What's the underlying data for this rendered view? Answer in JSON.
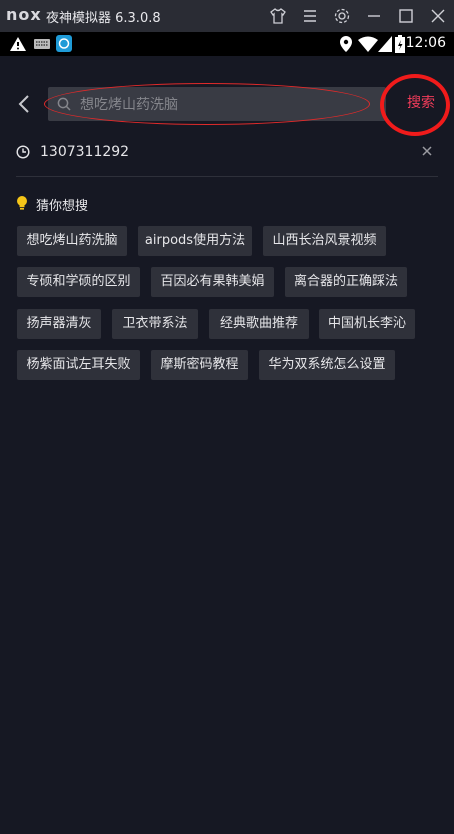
{
  "emulator": {
    "logo": "nox",
    "title": "夜神模拟器 6.3.0.8",
    "icons": [
      "shirt-icon",
      "menu-icon",
      "gear-icon",
      "minimize-icon",
      "maximize-icon",
      "close-icon"
    ]
  },
  "statusbar": {
    "icons": [
      "warning-icon",
      "keyboard-icon",
      "app-icon",
      "location-icon",
      "wifi-icon",
      "signal-icon",
      "battery-icon"
    ],
    "time": "12:06"
  },
  "search": {
    "placeholder": "想吃烤山药洗脑",
    "button": "搜索",
    "annotation_color": "#e02a2a"
  },
  "history": {
    "items": [
      {
        "text": "1307311292"
      }
    ]
  },
  "suggestions": {
    "title": "猜你想搜",
    "items": [
      "想吃烤山药洗脑",
      "airpods使用方法",
      "山西长治风景视频",
      "专硕和学硕的区别",
      "百因必有果韩美娟",
      "离合器的正确踩法",
      "扬声器清灰",
      "卫衣带系法",
      "经典歌曲推荐",
      "中国机长李沁",
      "杨紫面试左耳失败",
      "摩斯密码教程",
      "华为双系统怎么设置"
    ]
  },
  "colors": {
    "background": "#161823",
    "accent": "#f23c5a",
    "chip": "#2f313a"
  }
}
